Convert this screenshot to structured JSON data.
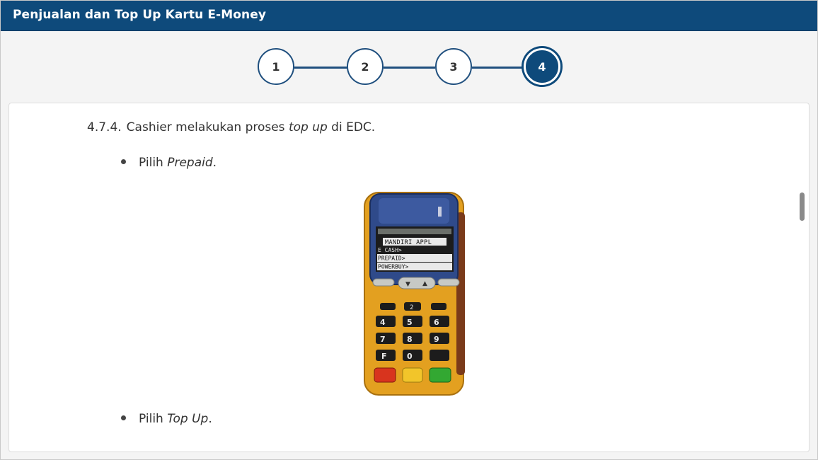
{
  "window": {
    "title": "Penjualan dan Top Up Kartu E-Money"
  },
  "stepper": {
    "steps": [
      "1",
      "2",
      "3",
      "4"
    ],
    "active_step": "4"
  },
  "content": {
    "step_number": "4.7.4.",
    "step_text_prefix": "Cashier melakukan proses ",
    "step_text_italic": "top up",
    "step_text_suffix": " di EDC.",
    "bullets": [
      {
        "prefix": "Pilih ",
        "italic": "Prepaid",
        "suffix": "."
      },
      {
        "prefix": "Pilih ",
        "italic": "Top Up",
        "suffix": "."
      }
    ]
  },
  "edc_device": {
    "screen_lines": [
      "MANDIRI APPL",
      "E CASH>",
      "PREPAID>",
      "POWERBUY>"
    ],
    "keys": [
      "2",
      "4",
      "5",
      "6",
      "7",
      "8",
      "9",
      "F",
      "0"
    ],
    "colors": {
      "body": "#e8a21f",
      "screen": "#2a3f7c",
      "highlight": "#1a1a1a"
    }
  },
  "colors": {
    "title_bar": "#0e4a7b",
    "accent": "#1f4f7e",
    "text": "#333333"
  }
}
